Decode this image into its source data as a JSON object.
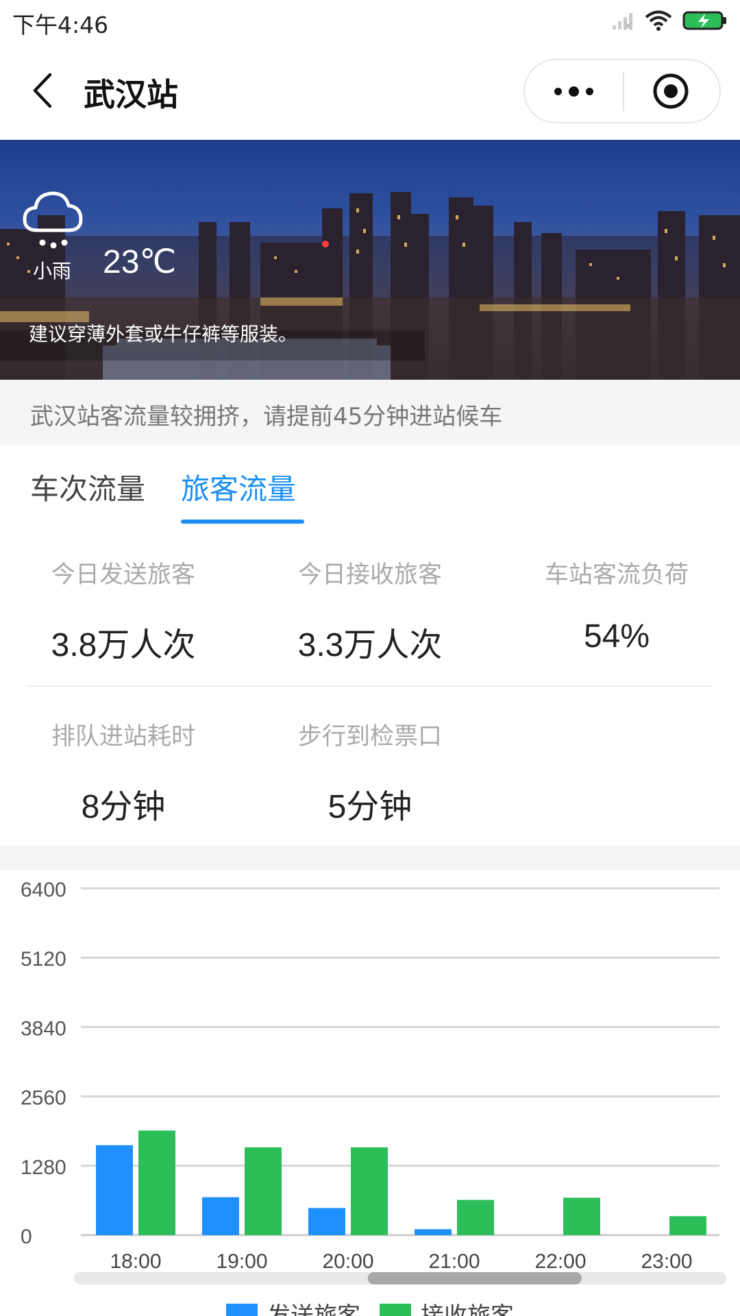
{
  "status_bar": {
    "time": "下午4:46"
  },
  "nav": {
    "title": "武汉站"
  },
  "weather": {
    "icon": "rain-cloud-icon",
    "condition": "小雨",
    "temperature": "23℃",
    "tip": "建议穿薄外套或牛仔裤等服装。"
  },
  "notice": {
    "text": "武汉站客流量较拥挤，请提前45分钟进站候车"
  },
  "tabs": [
    {
      "label": "车次流量",
      "active": false
    },
    {
      "label": "旅客流量",
      "active": true
    }
  ],
  "stats": {
    "row1": [
      {
        "label": "今日发送旅客",
        "value": "3.8万人次"
      },
      {
        "label": "今日接收旅客",
        "value": "3.3万人次"
      },
      {
        "label": "车站客流负荷",
        "value": "54%"
      }
    ],
    "row2": [
      {
        "label": "排队进站耗时",
        "value": "8分钟"
      },
      {
        "label": "步行到检票口",
        "value": "5分钟"
      }
    ]
  },
  "colors": {
    "accent": "#1c8ff5",
    "send": "#1e90ff",
    "receive": "#2dbe5a"
  },
  "chart_data": {
    "type": "bar",
    "categories": [
      "18:00",
      "19:00",
      "20:00",
      "21:00",
      "22:00",
      "23:00"
    ],
    "series": [
      {
        "name": "发送旅客",
        "values": [
          1660,
          700,
          500,
          110,
          0,
          0
        ]
      },
      {
        "name": "接收旅客",
        "values": [
          1930,
          1620,
          1620,
          650,
          690,
          350
        ]
      }
    ],
    "yticks": [
      0,
      1280,
      2560,
      3840,
      5120,
      6400
    ],
    "ylim": [
      0,
      6400
    ],
    "grid": true,
    "legend_position": "bottom",
    "scrollbar_position": 0.67
  }
}
